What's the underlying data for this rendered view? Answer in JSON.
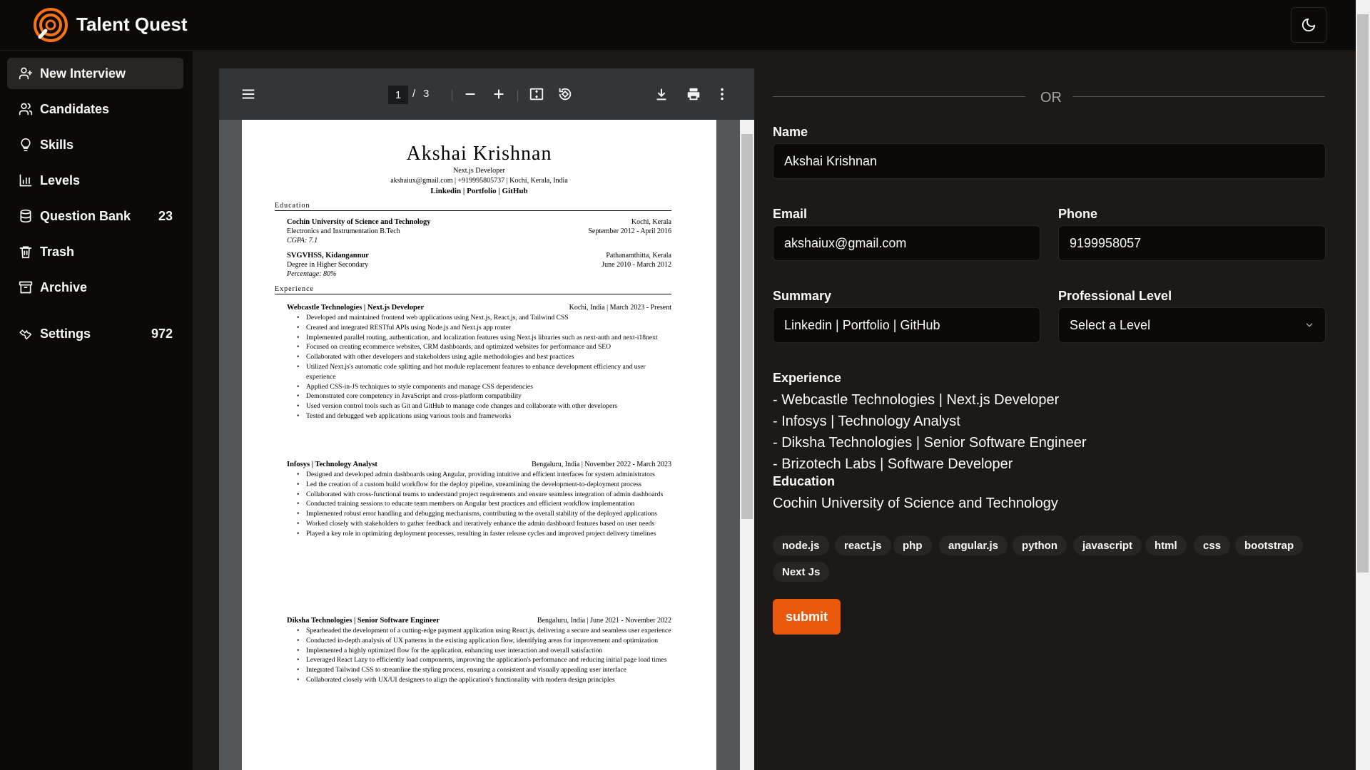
{
  "app": {
    "title": "Talent Quest"
  },
  "sidebar": {
    "items": [
      {
        "label": "New Interview",
        "icon": "user-plus-icon",
        "active": true
      },
      {
        "label": "Candidates",
        "icon": "users-icon"
      },
      {
        "label": "Skills",
        "icon": "lightbulb-icon"
      },
      {
        "label": "Levels",
        "icon": "bar-chart-icon"
      },
      {
        "label": "Question Bank",
        "icon": "database-icon",
        "count": "23"
      },
      {
        "label": "Trash",
        "icon": "trash-icon"
      },
      {
        "label": "Archive",
        "icon": "archive-icon"
      },
      {
        "label": "Settings",
        "icon": "wrench-icon",
        "count": "972"
      }
    ]
  },
  "pdf": {
    "current_page": "1",
    "separator": "/",
    "total_pages": "3",
    "resume": {
      "name": "Akshai Krishnan",
      "role": "Next.js Developer",
      "contact": "akshaiux@gmail.com | +919995805737 | Kochi, Kerala, India",
      "links": "Linkedin | Portfolio | GitHub",
      "education_heading": "Education",
      "education": [
        {
          "school": "Cochin University of Science and Technology",
          "place": "Kochi, Kerala",
          "degree": "Electronics and Instrumentation B.Tech",
          "dates": "September 2012 - April 2016",
          "score": "CGPA: 7.1"
        },
        {
          "school": "SVGVHSS, Kidangannur",
          "place": "Pathanamthitta, Kerala",
          "degree": "Degree in Higher Secondary",
          "dates": "June 2010 - March 2012",
          "score": "Percentage: 80%"
        }
      ],
      "experience_heading": "Experience",
      "experience": [
        {
          "title": "Webcastle Technologies | Next.js Developer",
          "meta": "Kochi, India | March 2023 - Present",
          "bullets": [
            "Developed and maintained frontend web applications using Next.js, React.js, and Tailwind CSS",
            "Created and integrated RESTful APIs using Node.js and Next.js app router",
            "Implemented parallel routing, authentication, and localization features using Next.js libraries such as next-auth and next-i18next",
            "Focused on creating ecommerce websites, CRM dashboards, and optimized websites for performance and SEO",
            "Collaborated with other developers and stakeholders using agile methodologies and best practices",
            "Utilized Next.js's automatic code splitting and hot module replacement features to enhance development efficiency and user experience",
            "Applied CSS-in-JS techniques to style components and manage CSS dependencies",
            "Demonstrated core competency in JavaScript and cross-platform compatibility",
            "Used version control tools such as Git and GitHub to manage code changes and collaborate with other developers",
            "Tested and debugged web applications using various tools and frameworks"
          ]
        },
        {
          "title": "Infosys | Technology Analyst",
          "meta": "Bengaluru, India | November 2022 - March 2023",
          "bullets": [
            "Designed and developed admin dashboards using Angular, providing intuitive and efficient interfaces for system administrators",
            "Led the creation of a custom build workflow for the deploy pipeline, streamlining the development-to-deployment process",
            "Collaborated with cross-functional teams to understand project requirements and ensure seamless integration of admin dashboards",
            "Conducted training sessions to educate team members on Angular best practices and efficient workflow implementation",
            "Implemented robust error handling and debugging mechanisms, contributing to the overall stability of the deployed applications",
            "Worked closely with stakeholders to gather feedback and iteratively enhance the admin dashboard features based on user needs",
            "Played a key role in optimizing deployment processes, resulting in faster release cycles and improved project delivery timelines"
          ]
        },
        {
          "title": "Diksha Technologies | Senior Software Engineer",
          "meta": "Bengaluru, India | June 2021 - November 2022",
          "bullets": [
            "Spearheaded the development of a cutting-edge payment application using React.js, delivering a secure and seamless user experience",
            "Conducted in-depth analysis of UX patterns in the existing application flow, identifying areas for improvement and optimization",
            "Implemented a highly optimized flow for the application, enhancing user interaction and overall satisfaction",
            "Leveraged React Lazy to efficiently load components, improving the application's performance and reducing initial page load times",
            "Integrated Tailwind CSS to streamline the styling process, ensuring a consistent and visually appealing user interface",
            "Collaborated closely with UX/UI designers to align the application's functionality with modern design principles"
          ]
        }
      ]
    }
  },
  "form": {
    "or_text": "OR",
    "name_label": "Name",
    "name_value": "Akshai Krishnan",
    "email_label": "Email",
    "email_value": "akshaiux@gmail.com",
    "phone_label": "Phone",
    "phone_value": "9199958057",
    "summary_label": "Summary",
    "summary_value": "Linkedin | Portfolio | GitHub",
    "level_label": "Professional Level",
    "level_value": "Select a Level",
    "experience_label": "Experience",
    "experience_items": [
      "- Webcastle Technologies | Next.js Developer",
      "- Infosys | Technology Analyst",
      "- Diksha Technologies | Senior Software Engineer",
      "- Brizotech Labs | Software Developer"
    ],
    "education_label": "Education",
    "education_value": "Cochin University of Science and Technology",
    "skills": [
      "node.js",
      "react.js",
      "php",
      "angular.js",
      "python",
      "javascript",
      "html",
      "css",
      "bootstrap",
      "Next Js"
    ],
    "submit_label": "submit"
  },
  "colors": {
    "accent": "#ea580c",
    "background": "#0c0a09",
    "panel": "#1c1917"
  }
}
